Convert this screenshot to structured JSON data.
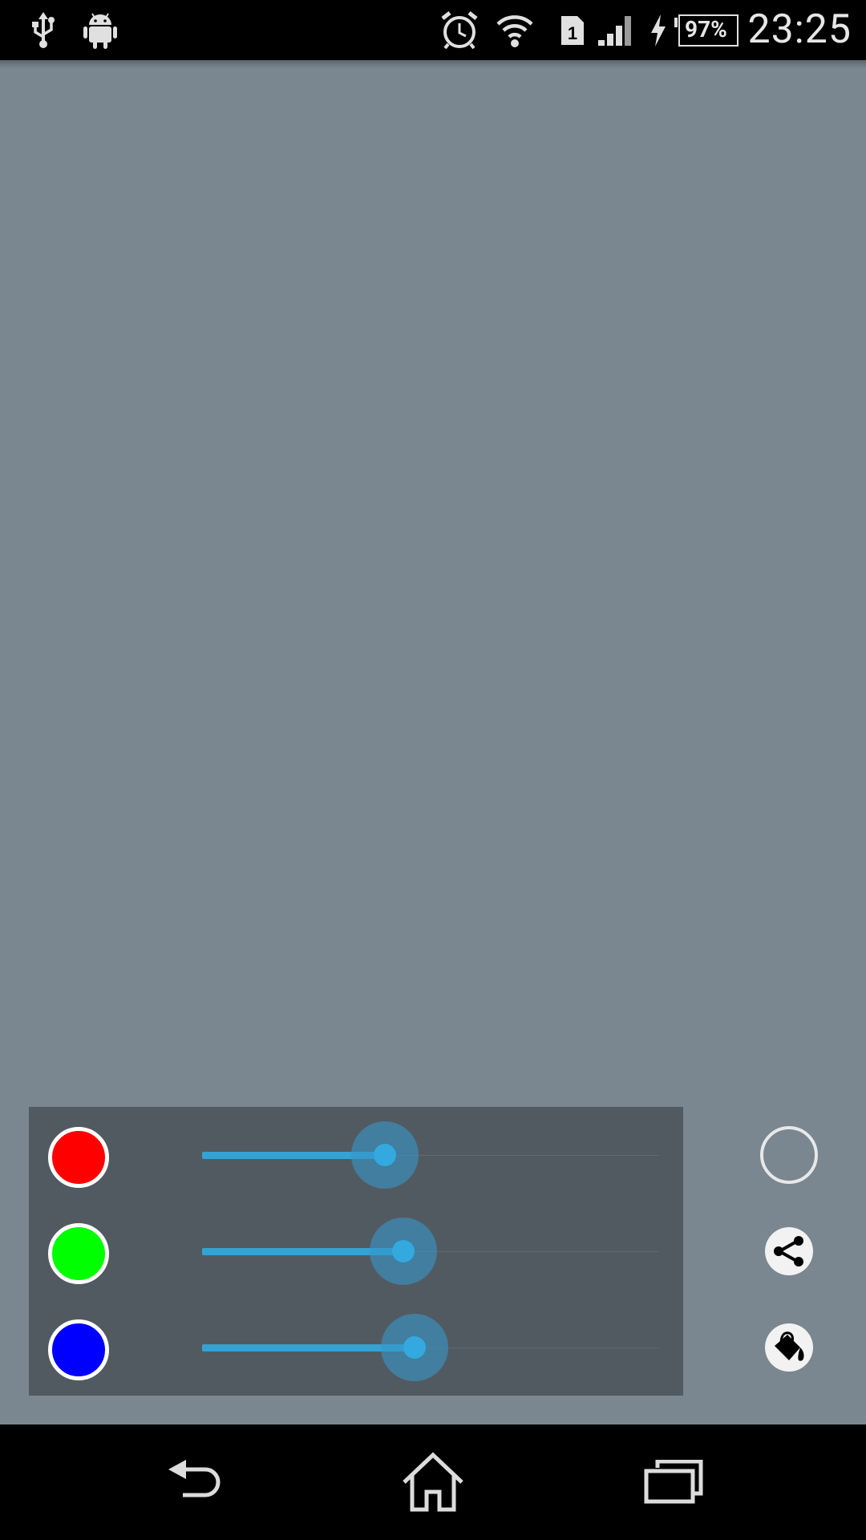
{
  "status_bar": {
    "icons": [
      "usb-icon",
      "android-icon",
      "alarm-icon",
      "wifi-icon",
      "sim-icon",
      "signal-icon",
      "charging-icon",
      "battery-icon"
    ],
    "sim_number": "1",
    "battery_percent": "97%",
    "time": "23:25"
  },
  "controls": {
    "sliders": [
      {
        "channel": "red",
        "swatch_color": "#ff0000",
        "level": 0.4
      },
      {
        "channel": "green",
        "swatch_color": "#00ff00",
        "level": 0.44
      },
      {
        "channel": "blue",
        "swatch_color": "#0000ff",
        "level": 0.465
      }
    ],
    "actions": [
      "circle-outline-icon",
      "share-icon",
      "paint-bucket-icon"
    ]
  },
  "nav_bar": {
    "buttons": [
      "back-icon",
      "home-icon",
      "recent-apps-icon"
    ]
  },
  "colors": {
    "preview_background": "#7a8790",
    "accent": "#33a3d3"
  }
}
